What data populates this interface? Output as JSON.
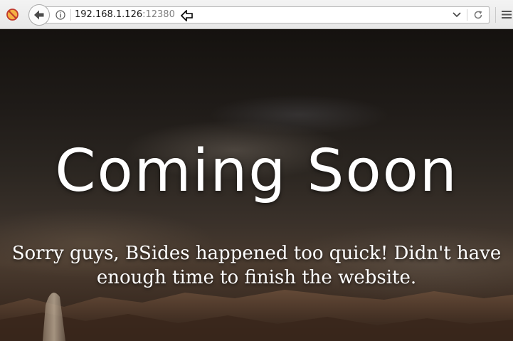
{
  "browser": {
    "url_host": "192.168.1.126",
    "url_port": ":12380",
    "icons": {
      "site": "blocked-site-icon",
      "back": "back-arrow-icon",
      "info": "info-icon",
      "dropdown": "chevron-down-icon",
      "reload": "reload-icon",
      "menu": "hamburger-menu-icon",
      "cursor": "mouse-cursor-icon"
    }
  },
  "page": {
    "heading": "Coming Soon",
    "message": "Sorry guys, BSides happened too quick! Didn't have enough time to finish the website."
  },
  "colors": {
    "toolbar": "#eeeeee",
    "heading_text": "#ffffff",
    "port_text": "#808080"
  }
}
